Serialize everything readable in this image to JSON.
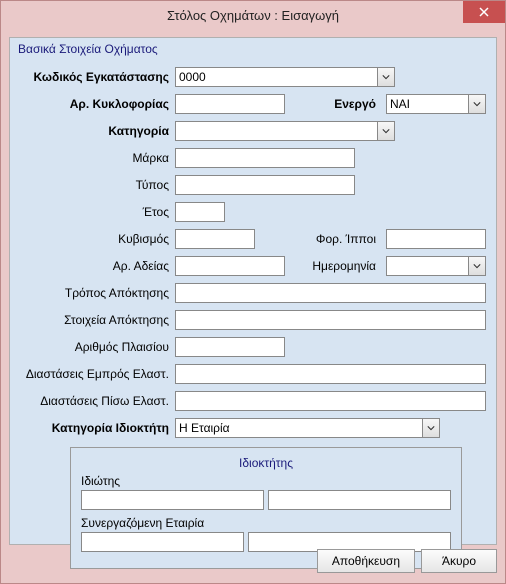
{
  "window": {
    "title": "Στόλος Οχημάτων : Εισαγωγή"
  },
  "group": {
    "title": "Βασικά Στοιχεία Οχήματος"
  },
  "labels": {
    "installCode": "Κωδικός Εγκατάστασης",
    "plate": "Αρ. Κυκλοφορίας",
    "active": "Ενεργό",
    "category": "Κατηγορία",
    "brand": "Μάρκα",
    "type": "Τύπος",
    "year": "Έτος",
    "cc": "Κυβισμός",
    "hp": "Φορ. Ίπποι",
    "licenceNo": "Αρ. Αδείας",
    "date": "Ημερομηνία",
    "acqMethod": "Τρόπος Απόκτησης",
    "acqDetails": "Στοιχεία Απόκτησης",
    "chassis": "Αριθμός Πλαισίου",
    "frontTyre": "Διαστάσεις Εμπρός Ελαστ.",
    "rearTyre": "Διαστάσεις Πίσω Ελαστ.",
    "ownerCategory": "Κατηγορία Ιδιοκτήτη"
  },
  "values": {
    "installCode": "0000",
    "plate": "",
    "active": "ΝΑΙ",
    "category": "",
    "brand": "",
    "type": "",
    "year": "",
    "cc": "",
    "hp": "",
    "licenceNo": "",
    "date": "",
    "acqMethod": "",
    "acqDetails": "",
    "chassis": "",
    "frontTyre": "",
    "rearTyre": "",
    "ownerCategory": "Η Εταιρία"
  },
  "owner": {
    "title": "Ιδιοκτήτης",
    "privateLabel": "Ιδιώτης",
    "companyLabel": "Συνεργαζόμενη Εταιρία",
    "privateCode": "",
    "privateName": "",
    "companyCode": "",
    "companyName": ""
  },
  "buttons": {
    "save": "Αποθήκευση",
    "cancel": "Άκυρο"
  }
}
